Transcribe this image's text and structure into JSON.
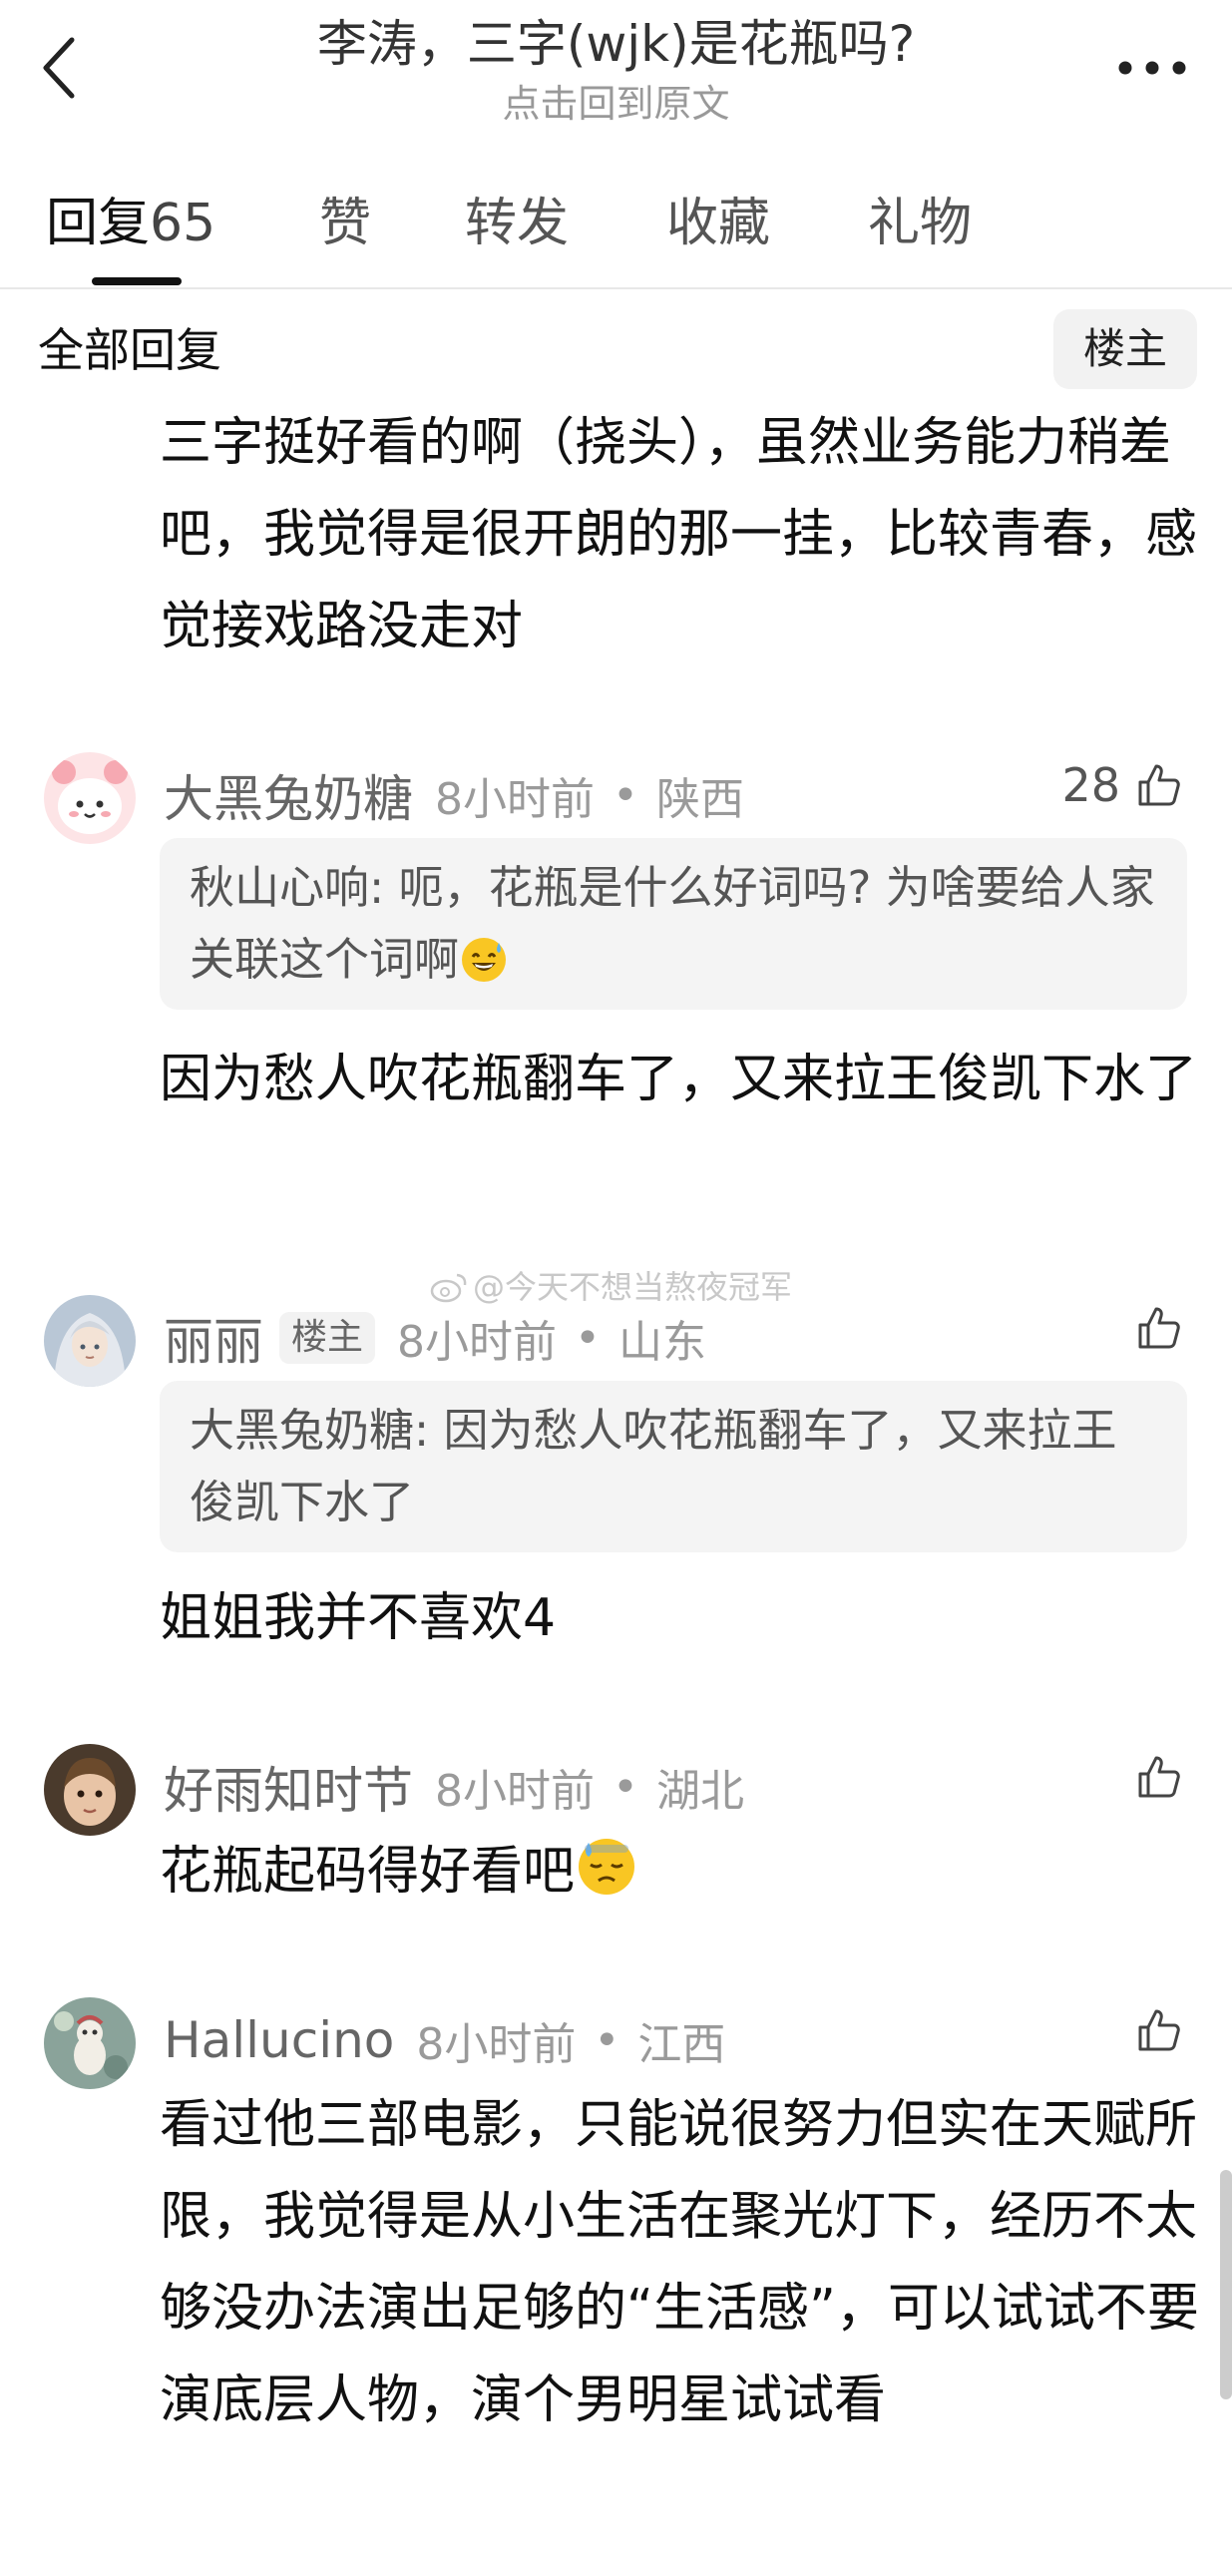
{
  "header": {
    "title": "李涛，三字(wjk)是花瓶吗?",
    "subtitle": "点击回到原文",
    "back_icon": "chevron-left-icon",
    "more_icon": "more-horizontal-icon"
  },
  "tabs": [
    {
      "label": "回复",
      "count": "65"
    },
    {
      "label": "赞"
    },
    {
      "label": "转发"
    },
    {
      "label": "收藏"
    },
    {
      "label": "礼物"
    }
  ],
  "filter": {
    "label": "全部回复",
    "op_only": "楼主"
  },
  "top_comment": {
    "text": "三字挺好看的啊（挠头），虽然业务能力稍差吧，我觉得是很开朗的那一挂，比较青春，感觉接戏路没走对"
  },
  "comments": [
    {
      "username": "大黑兔奶糖",
      "is_op": false,
      "time": "8小时前",
      "location": "陕西",
      "likes": "28",
      "quote": "秋山心响: 呃，花瓶是什么好词吗? 为啥要给人家关联这个词啊",
      "quote_emoji": "grinning-sweat-emoji",
      "text": "因为愁人吹花瓶翻车了，又来拉王俊凯下水了"
    },
    {
      "username": "丽丽",
      "is_op": true,
      "op_label": "楼主",
      "time": "8小时前",
      "location": "山东",
      "likes": "",
      "quote": "大黑兔奶糖: 因为愁人吹花瓶翻车了，又来拉王俊凯下水了",
      "text": "姐姐我并不喜欢4"
    },
    {
      "username": "好雨知时节",
      "is_op": false,
      "time": "8小时前",
      "location": "湖北",
      "likes": "",
      "text": "花瓶起码得好看吧",
      "text_emoji": "downcast-sweat-emoji"
    },
    {
      "username": "Hallucino",
      "is_op": false,
      "time": "8小时前",
      "location": "江西",
      "likes": "",
      "text": "看过他三部电影，只能说很努力但实在天赋所限，我觉得是从小生活在聚光灯下，经历不太够没办法演出足够的“生活感”，可以试试不要演底层人物，演个男明星试试看"
    }
  ],
  "watermark": "@今天不想当熬夜冠军",
  "colors": {
    "text_primary": "#111111",
    "text_secondary": "#666666",
    "text_muted": "#999999",
    "quote_bg": "#f4f4f4",
    "divider": "#e8e8e8"
  }
}
